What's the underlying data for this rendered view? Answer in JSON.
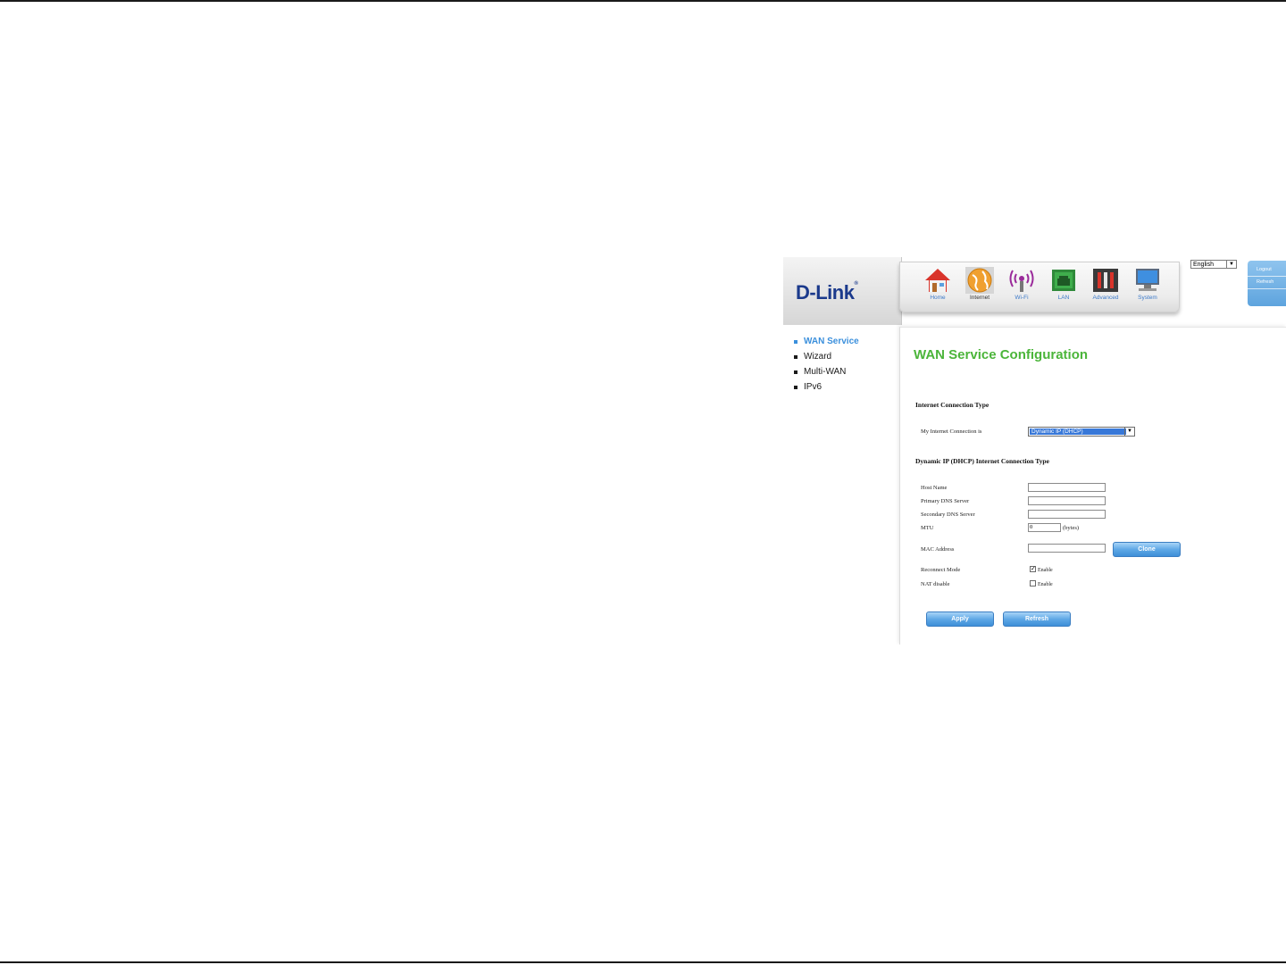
{
  "brand": {
    "logo": "D-Link",
    "reg": "®"
  },
  "nav": {
    "items": [
      {
        "label": "Home",
        "icon": "home-icon"
      },
      {
        "label": "Internet",
        "icon": "globe-icon"
      },
      {
        "label": "Wi-Fi",
        "icon": "wifi-icon"
      },
      {
        "label": "LAN",
        "icon": "lan-icon"
      },
      {
        "label": "Advanced",
        "icon": "tools-icon"
      },
      {
        "label": "System",
        "icon": "monitor-icon"
      }
    ],
    "active": "Internet"
  },
  "language": {
    "selected": "English"
  },
  "quick_links": {
    "logout": "Logout",
    "refresh": "Refresh"
  },
  "sidebar": {
    "items": [
      {
        "label": "WAN Service"
      },
      {
        "label": "Wizard"
      },
      {
        "label": "Multi-WAN"
      },
      {
        "label": "IPv6"
      }
    ],
    "active": "WAN Service"
  },
  "page": {
    "title": "WAN Service Configuration",
    "section1": "Internet Connection Type",
    "conn_label": "My Internet Connection is",
    "conn_value": "Dynamic IP (DHCP)",
    "section2": "Dynamic IP (DHCP) Internet Connection Type",
    "fields": {
      "host_name": {
        "label": "Host Name",
        "value": ""
      },
      "primary_dns": {
        "label": "Primary DNS Server",
        "value": ""
      },
      "secondary_dns": {
        "label": "Secondary DNS Server",
        "value": ""
      },
      "mtu": {
        "label": "MTU",
        "value": "0",
        "unit": "(bytes)"
      },
      "mac": {
        "label": "MAC Address",
        "value": ""
      }
    },
    "clone_button": "Clone",
    "reconnect": {
      "label": "Reconnect Mode",
      "option": "Enable",
      "checked": true
    },
    "nat": {
      "label": "NAT disable",
      "option": "Enable",
      "checked": false
    },
    "apply_button": "Apply",
    "refresh_button": "Refresh"
  },
  "colors": {
    "title_green": "#4bb53a",
    "link_blue": "#3a8fdc",
    "logo_blue": "#1b3a8c",
    "button_blue": "#5fa8e6"
  }
}
